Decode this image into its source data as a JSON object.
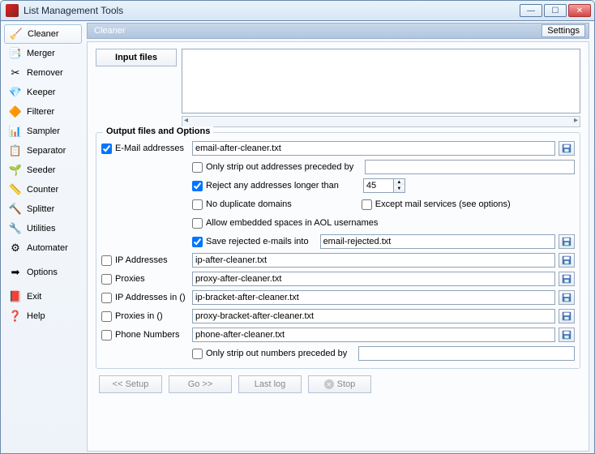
{
  "window": {
    "title": "List Management Tools"
  },
  "sidebar": {
    "items": [
      {
        "label": "Cleaner",
        "icon": "🧹",
        "active": true
      },
      {
        "label": "Merger",
        "icon": "📑",
        "active": false
      },
      {
        "label": "Remover",
        "icon": "✂",
        "active": false
      },
      {
        "label": "Keeper",
        "icon": "💎",
        "active": false
      },
      {
        "label": "Filterer",
        "icon": "🔶",
        "active": false
      },
      {
        "label": "Sampler",
        "icon": "📊",
        "active": false
      },
      {
        "label": "Separator",
        "icon": "📋",
        "active": false
      },
      {
        "label": "Seeder",
        "icon": "🌱",
        "active": false
      },
      {
        "label": "Counter",
        "icon": "📏",
        "active": false
      },
      {
        "label": "Splitter",
        "icon": "🔨",
        "active": false
      },
      {
        "label": "Utilities",
        "icon": "🔧",
        "active": false
      },
      {
        "label": "Automater",
        "icon": "⚙",
        "active": false
      },
      {
        "label": "Options",
        "icon": "➡",
        "active": false
      },
      {
        "label": "Exit",
        "icon": "📕",
        "active": false
      },
      {
        "label": "Help",
        "icon": "❓",
        "active": false
      }
    ]
  },
  "panel": {
    "title": "Cleaner",
    "settings_label": "Settings"
  },
  "input_files": {
    "button_label": "Input files",
    "value": ""
  },
  "group": {
    "title": "Output files and Options",
    "email": {
      "checked": true,
      "label": "E-Mail addresses",
      "value": "email-after-cleaner.txt"
    },
    "strip_preceded": {
      "checked": false,
      "label": "Only strip out addresses preceded by",
      "value": ""
    },
    "reject_longer": {
      "checked": true,
      "label": "Reject any addresses longer than",
      "value": "45"
    },
    "no_dup": {
      "checked": false,
      "label": "No duplicate domains"
    },
    "except_mail": {
      "checked": false,
      "label": "Except mail services (see options)"
    },
    "allow_aol": {
      "checked": false,
      "label": "Allow embedded spaces in AOL usernames"
    },
    "save_rejected": {
      "checked": true,
      "label": "Save rejected e-mails into",
      "value": "email-rejected.txt"
    },
    "ip": {
      "checked": false,
      "label": "IP Addresses",
      "value": "ip-after-cleaner.txt"
    },
    "proxies": {
      "checked": false,
      "label": "Proxies",
      "value": "proxy-after-cleaner.txt"
    },
    "ip_bracket": {
      "checked": false,
      "label": "IP Addresses in ()",
      "value": "ip-bracket-after-cleaner.txt"
    },
    "proxies_bracket": {
      "checked": false,
      "label": "Proxies in ()",
      "value": "proxy-bracket-after-cleaner.txt"
    },
    "phone": {
      "checked": false,
      "label": "Phone Numbers",
      "value": "phone-after-cleaner.txt"
    },
    "strip_numbers": {
      "checked": false,
      "label": "Only strip out numbers preceded by",
      "value": ""
    }
  },
  "buttons": {
    "setup": "<< Setup",
    "go": "Go >>",
    "lastlog": "Last log",
    "stop": "Stop"
  }
}
